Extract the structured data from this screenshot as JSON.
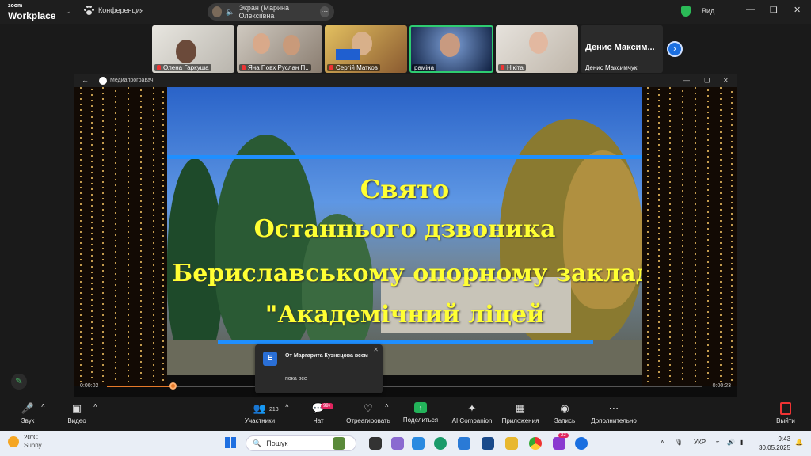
{
  "app": {
    "brand_small": "zoom",
    "brand_large": "Workplace",
    "meeting_label": "Конференция",
    "view_label": "Вид"
  },
  "share_pill": {
    "label": "Экран (Марина Олексіївна"
  },
  "participants": [
    {
      "name": "Олена Гаркуша",
      "muted": true
    },
    {
      "name": "Яна  Повх  Руслан  П..",
      "muted": true
    },
    {
      "name": "Сергій Матков",
      "muted": true
    },
    {
      "name": "раміна",
      "muted": false,
      "active": true
    },
    {
      "name": "Нікіта",
      "muted": true
    },
    {
      "name": "Денис Максимчук",
      "display_text": "Денис  Максим...",
      "muted": false
    }
  ],
  "media_player": {
    "title": "Медиапрогравач",
    "time_current": "0:00:02",
    "time_total": "0:00:23",
    "progress": 0.11
  },
  "slide": {
    "lines": [
      "Свято",
      "Останнього дзвоника",
      "у Бериславському опорному закладі",
      "\"Академічний ліцей"
    ]
  },
  "chat": {
    "avatar_letter": "Е",
    "from": "От Маргарита Кузнецова всем",
    "message": "пока все"
  },
  "toolbar": {
    "audio": "Звук",
    "video": "Видео",
    "participants": "Участники",
    "participants_count": "213",
    "chat": "Чат",
    "chat_badge": "99+",
    "react": "Отреагировать",
    "share": "Поделиться",
    "ai": "AI Companion",
    "apps": "Приложения",
    "record": "Запись",
    "more": "Дополнительно",
    "leave": "Выйти"
  },
  "taskbar": {
    "temp": "20°C",
    "weather": "Sunny",
    "search_placeholder": "Пошук",
    "lang": "УКР",
    "time": "9:43",
    "date": "30.05.2025",
    "badge": "22"
  }
}
